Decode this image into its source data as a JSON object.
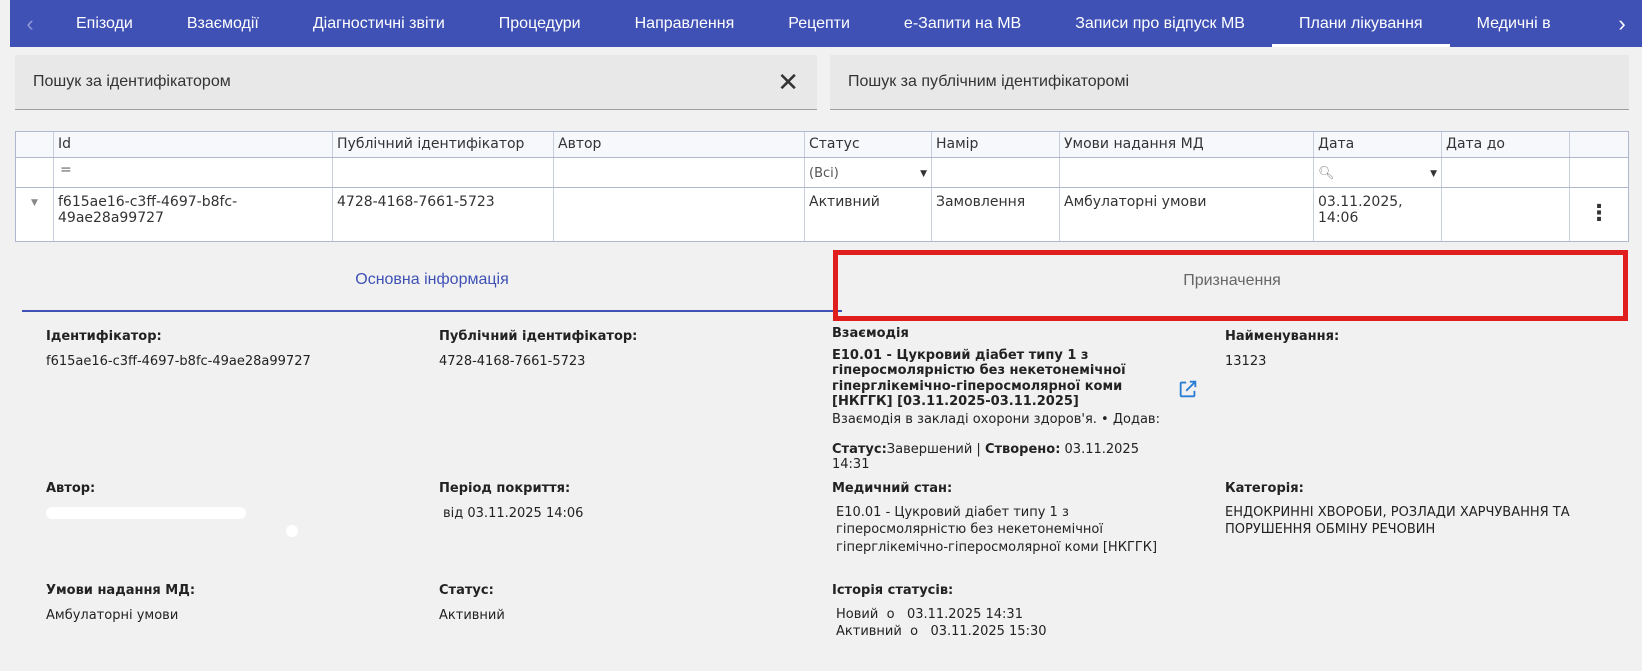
{
  "nav": {
    "tabs": [
      "Епізоди",
      "Взаємодії",
      "Діагностичні звіти",
      "Процедури",
      "Направлення",
      "Рецепти",
      "е-Запити на МВ",
      "Записи про відпуск МВ",
      "Плани лікування",
      "Медичні в"
    ],
    "active_index": 8,
    "accent": "#3f51b5"
  },
  "search": {
    "id_placeholder": "Пошук за ідентифікатором",
    "public_placeholder": "Пошук за публічним ідентифікаторомі"
  },
  "grid": {
    "columns": [
      "Id",
      "Публічний ідентифікатор",
      "Автор",
      "Статус",
      "Намір",
      "Умови надання МД",
      "Дата",
      "Дата до"
    ],
    "filter": {
      "id_symbol": "=",
      "status": "(Всі)"
    },
    "row": {
      "id": "f615ae16-c3ff-4697-b8fc-49ae28a99727",
      "public_id": "4728-4168-7661-5723",
      "author": "",
      "status": "Активний",
      "intent": "Замовлення",
      "conditions": "Амбулаторні умови",
      "date": "03.11.2025, 14:06",
      "date_to": ""
    }
  },
  "detail_tabs": {
    "main": "Основна інформація",
    "assignments": "Призначення"
  },
  "details": {
    "identifier_label": "Ідентифікатор:",
    "identifier_value": "f615ae16-c3ff-4697-b8fc-49ae28a99727",
    "public_id_label": "Публічний ідентифікатор:",
    "public_id_value": "4728-4168-7661-5723",
    "interaction_label": "Взаємодія",
    "interaction_title": "E10.01 - Цукровий діабет типу 1 з гіперосмолярністю без некетонемічної гіперглікемічно-гіперосмолярної коми [НКГГК] [03.11.2025-03.11.2025]",
    "interaction_sub": "Взаємодія в закладі охорони здоров'я. • Додав:",
    "interaction_status_label": "Статус:",
    "interaction_status_value": "Завершений",
    "interaction_sep": " | ",
    "interaction_created_label": "Створено:",
    "interaction_created_value": " 03.11.2025 14:31",
    "name_label": "Найменування:",
    "name_value": "13123",
    "author_label": "Автор:",
    "period_label": "Період покриття:",
    "period_value": "від 03.11.2025 14:06",
    "condition_label": "Медичний стан:",
    "condition_value": "E10.01 - Цукровий діабет типу 1 з гіперосмолярністю без некетонемічної гіперглікемічно-гіперосмолярної коми [НКГГК]",
    "category_label": "Категорія:",
    "category_value": "ЕНДОКРИННІ ХВОРОБИ, РОЗЛАДИ ХАРЧУВАННЯ ТА ПОРУШЕННЯ ОБМІНУ РЕЧОВИН",
    "conditions_label": "Умови надання МД:",
    "conditions_value": "Амбулаторні умови",
    "status_label": "Статус:",
    "status_value": "Активний",
    "history_label": "Історія статусів:",
    "history": [
      {
        "status": "Новий",
        "sep": "о",
        "time": "03.11.2025 14:31"
      },
      {
        "status": "Активний",
        "sep": "о",
        "time": "03.11.2025 15:30"
      }
    ]
  },
  "colors": {
    "highlight": "#e01e1e",
    "link": "#2a7dd4"
  }
}
